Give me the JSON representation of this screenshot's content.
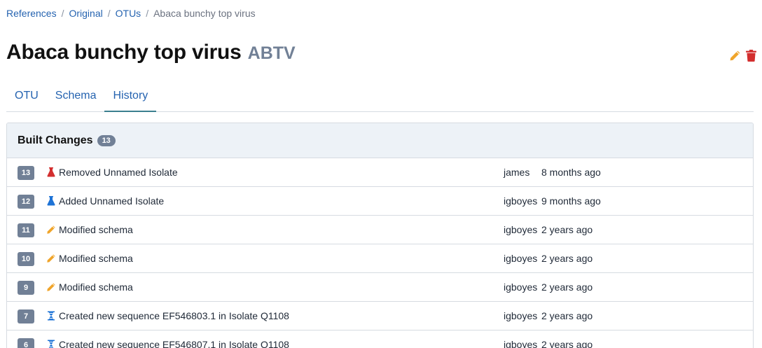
{
  "breadcrumb": {
    "items": [
      "References",
      "Original",
      "OTUs"
    ],
    "current": "Abaca bunchy top virus"
  },
  "header": {
    "title": "Abaca bunchy top virus",
    "abbreviation": "ABTV",
    "edit_icon": "pencil-icon",
    "delete_icon": "trash-icon"
  },
  "tabs": [
    {
      "label": "OTU",
      "active": false
    },
    {
      "label": "Schema",
      "active": false
    },
    {
      "label": "History",
      "active": true
    }
  ],
  "changes": {
    "title": "Built Changes",
    "count": "13",
    "rows": [
      {
        "index": "13",
        "icon": "flask-icon",
        "icon_color": "#d32f2f",
        "description": "Removed Unnamed Isolate",
        "user": "james",
        "time": "8 months ago"
      },
      {
        "index": "12",
        "icon": "flask-icon",
        "icon_color": "#1e73d6",
        "description": "Added Unnamed Isolate",
        "user": "igboyes",
        "time": "9 months ago"
      },
      {
        "index": "11",
        "icon": "pencil-icon",
        "icon_color": "#f0a52b",
        "description": "Modified schema",
        "user": "igboyes",
        "time": "2 years ago"
      },
      {
        "index": "10",
        "icon": "pencil-icon",
        "icon_color": "#f0a52b",
        "description": "Modified schema",
        "user": "igboyes",
        "time": "2 years ago"
      },
      {
        "index": "9",
        "icon": "pencil-icon",
        "icon_color": "#f0a52b",
        "description": "Modified schema",
        "user": "igboyes",
        "time": "2 years ago"
      },
      {
        "index": "7",
        "icon": "dna-icon",
        "icon_color": "#1e73d6",
        "description": "Created new sequence EF546803.1 in Isolate Q1108",
        "user": "igboyes",
        "time": "2 years ago"
      },
      {
        "index": "6",
        "icon": "dna-icon",
        "icon_color": "#1e73d6",
        "description": "Created new sequence EF546807.1 in Isolate Q1108",
        "user": "igboyes",
        "time": "2 years ago"
      }
    ]
  },
  "colors": {
    "link": "#2563b0",
    "badge": "#718096",
    "edit": "#f0a52b",
    "delete": "#d32f2f"
  }
}
